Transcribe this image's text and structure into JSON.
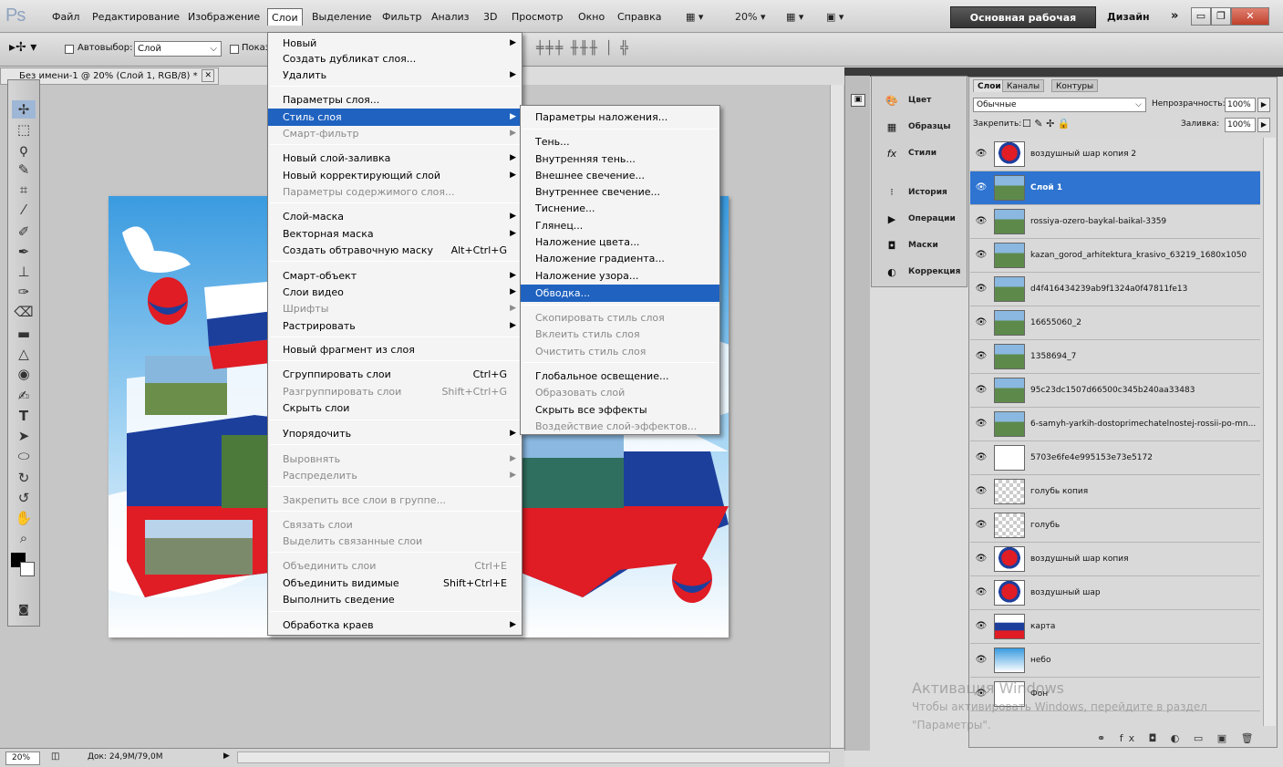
{
  "app": {
    "logo": "Ps"
  },
  "menubar": {
    "items": [
      "Файл",
      "Редактирование",
      "Изображение",
      "Слои",
      "Выделение",
      "Фильтр",
      "Анализ",
      "3D",
      "Просмотр",
      "Окно",
      "Справка"
    ],
    "zoom": "20%",
    "workspace": "Основная рабочая среда",
    "design": "Дизайн",
    "more": "»"
  },
  "options": {
    "autoselect_label": "Автовыбор:",
    "autoselect_value": "Слой",
    "show_label": "Показ"
  },
  "document": {
    "tab_title": "Без имени-1 @ 20% (Слой 1, RGB/8) *"
  },
  "layer_menu": {
    "items": [
      {
        "label": "Новый",
        "arrow": true
      },
      {
        "label": "Создать дубликат слоя..."
      },
      {
        "label": "Удалить",
        "arrow": true
      },
      {
        "label": "Параметры слоя..."
      },
      {
        "label": "Стиль слоя",
        "arrow": true,
        "hl": true
      },
      {
        "label": "Смарт-фильтр",
        "arrow": true,
        "dis": true
      },
      {
        "label": "Новый слой-заливка",
        "arrow": true
      },
      {
        "label": "Новый корректирующий слой",
        "arrow": true
      },
      {
        "label": "Параметры содержимого слоя...",
        "dis": true
      },
      {
        "label": "Слой-маска",
        "arrow": true
      },
      {
        "label": "Векторная маска",
        "arrow": true
      },
      {
        "label": "Создать обтравочную маску",
        "sc": "Alt+Ctrl+G"
      },
      {
        "label": "Смарт-объект",
        "arrow": true
      },
      {
        "label": "Слои видео",
        "arrow": true
      },
      {
        "label": "Шрифты",
        "arrow": true,
        "dis": true
      },
      {
        "label": "Растрировать",
        "arrow": true
      },
      {
        "label": "Новый фрагмент из слоя"
      },
      {
        "label": "Сгруппировать слои",
        "sc": "Ctrl+G"
      },
      {
        "label": "Разгруппировать слои",
        "sc": "Shift+Ctrl+G",
        "dis": true
      },
      {
        "label": "Скрыть слои"
      },
      {
        "label": "Упорядочить",
        "arrow": true
      },
      {
        "label": "Выровнять",
        "arrow": true,
        "dis": true
      },
      {
        "label": "Распределить",
        "arrow": true,
        "dis": true
      },
      {
        "label": "Закрепить все слои в группе...",
        "dis": true
      },
      {
        "label": "Связать слои",
        "dis": true
      },
      {
        "label": "Выделить связанные слои",
        "dis": true
      },
      {
        "label": "Объединить слои",
        "sc": "Ctrl+E",
        "dis": true
      },
      {
        "label": "Объединить видимые",
        "sc": "Shift+Ctrl+E"
      },
      {
        "label": "Выполнить сведение"
      },
      {
        "label": "Обработка краев",
        "arrow": true
      }
    ]
  },
  "style_menu": {
    "items": [
      {
        "label": "Параметры наложения..."
      },
      {
        "label": "Тень..."
      },
      {
        "label": "Внутренняя тень..."
      },
      {
        "label": "Внешнее свечение..."
      },
      {
        "label": "Внутреннее свечение..."
      },
      {
        "label": "Тиснение..."
      },
      {
        "label": "Глянец..."
      },
      {
        "label": "Наложение цвета..."
      },
      {
        "label": "Наложение градиента..."
      },
      {
        "label": "Наложение узора..."
      },
      {
        "label": "Обводка...",
        "hl": true
      },
      {
        "label": "Скопировать стиль слоя",
        "dis": true
      },
      {
        "label": "Вклеить стиль слоя",
        "dis": true
      },
      {
        "label": "Очистить стиль слоя",
        "dis": true
      },
      {
        "label": "Глобальное освещение..."
      },
      {
        "label": "Образовать слой",
        "dis": true
      },
      {
        "label": "Скрыть все эффекты"
      },
      {
        "label": "Воздействие слой-эффектов...",
        "dis": true
      }
    ]
  },
  "dock": {
    "items": [
      {
        "label": "Цвет",
        "icon": "color-icon"
      },
      {
        "label": "Образцы",
        "icon": "swatches-icon"
      },
      {
        "label": "Стили",
        "icon": "styles-icon"
      },
      {
        "label": "История",
        "icon": "history-icon"
      },
      {
        "label": "Операции",
        "icon": "actions-icon"
      },
      {
        "label": "Маски",
        "icon": "masks-icon"
      },
      {
        "label": "Коррекция",
        "icon": "adjustments-icon"
      }
    ]
  },
  "layers": {
    "tabs": [
      "Слои",
      "Каналы",
      "Контуры"
    ],
    "blend_mode": "Обычные",
    "opacity_label": "Непрозрачность:",
    "opacity_value": "100%",
    "lock_label": "Закрепить:",
    "fill_label": "Заливка:",
    "fill_value": "100%",
    "items": [
      {
        "name": "воздушный шар копия 2",
        "kind": "balloon"
      },
      {
        "name": "Слой 1",
        "kind": "photo",
        "sel": true
      },
      {
        "name": "rossiya-ozero-baykal-baikal-3359",
        "kind": "photo"
      },
      {
        "name": "kazan_gorod_arhitektura_krasivo_63219_1680x1050",
        "kind": "photo"
      },
      {
        "name": "d4f416434239ab9f1324a0f47811fe13",
        "kind": "photo"
      },
      {
        "name": "16655060_2",
        "kind": "photo"
      },
      {
        "name": "1358694_7",
        "kind": "photo"
      },
      {
        "name": "95c23dc1507d66500c345b240aa33483",
        "kind": "photo"
      },
      {
        "name": "6-samyh-yarkih-dostoprimechatelnostej-rossii-po-mn...",
        "kind": "photo"
      },
      {
        "name": "5703e6fe4e995153e73e5172",
        "kind": "smart"
      },
      {
        "name": "голубь копия",
        "kind": "trans"
      },
      {
        "name": "голубь",
        "kind": "trans"
      },
      {
        "name": "воздушный шар копия",
        "kind": "balloon"
      },
      {
        "name": "воздушный шар",
        "kind": "balloon"
      },
      {
        "name": "карта",
        "kind": "map"
      },
      {
        "name": "небо",
        "kind": "sky"
      },
      {
        "name": "Фон",
        "kind": "white"
      }
    ]
  },
  "status": {
    "zoom": "20%",
    "doc": "Док: 24,9M/79,0M"
  },
  "watermark": {
    "title": "Активация Windows",
    "line1": "Чтобы активировать Windows, перейдите в раздел",
    "line2": "\"Параметры\"."
  },
  "colors": {
    "highlight": "#1f62c0",
    "layer_selected": "#2e74d0",
    "flag_white": "#ffffff",
    "flag_blue": "#1d3f9c",
    "flag_red": "#e01c24"
  }
}
